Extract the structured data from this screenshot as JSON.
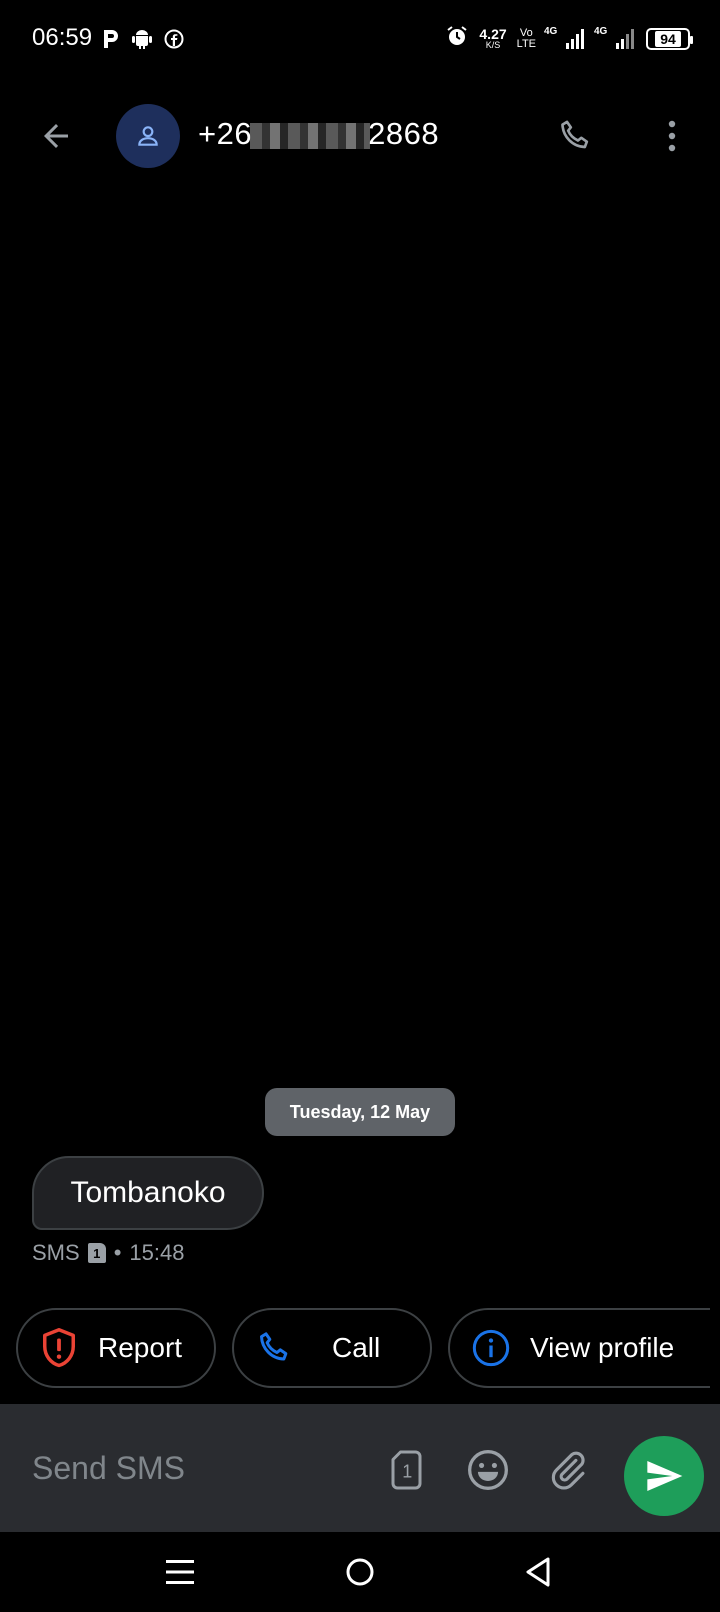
{
  "status_bar": {
    "time": "06:59",
    "net_speed_value": "4.27",
    "net_speed_unit": "K/S",
    "volte_top": "Vo",
    "volte_bottom": "LTE",
    "sim1_label": "4G",
    "sim2_label": "4G",
    "battery": "94",
    "left_icons": [
      "parking-icon",
      "android-icon",
      "facebook-icon"
    ],
    "right_icons": [
      "alarm-icon"
    ]
  },
  "header": {
    "contact_prefix": "+26",
    "contact_suffix": "2868"
  },
  "conversation": {
    "date_separator": "Tuesday, 12 May",
    "messages": [
      {
        "text": "Tombanoko",
        "type": "SMS",
        "sim": "1",
        "separator": "•",
        "time": "15:48"
      }
    ]
  },
  "actions": {
    "report": "Report",
    "call": "Call",
    "view_profile": "View profile"
  },
  "compose": {
    "placeholder": "Send SMS",
    "sim": "1"
  },
  "colors": {
    "background": "#000000",
    "compose_bg": "#2a2c30",
    "send_button": "#1e9e5a",
    "report_icon": "#ea4335",
    "call_icon": "#1a73e8",
    "profile_icon": "#1a73e8",
    "avatar_bg": "#1e2f5c",
    "date_chip_bg": "#5f6368"
  }
}
